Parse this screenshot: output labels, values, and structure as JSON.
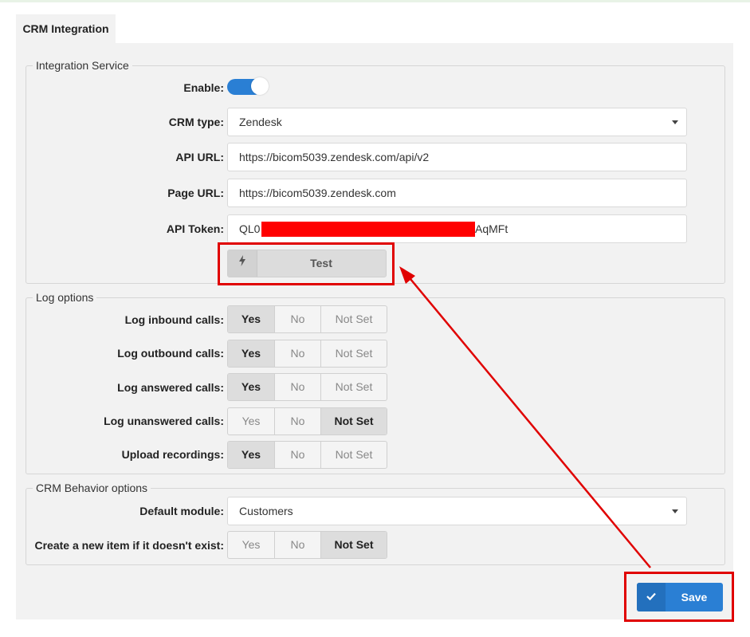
{
  "tab": {
    "label": "CRM Integration"
  },
  "integration": {
    "legend": "Integration Service",
    "enable_label": "Enable:",
    "enabled": true,
    "crm_type_label": "CRM type:",
    "crm_type_value": "Zendesk",
    "api_url_label": "API URL:",
    "api_url_value": "https://bicom5039.zendesk.com/api/v2",
    "page_url_label": "Page URL:",
    "page_url_value": "https://bicom5039.zendesk.com",
    "api_token_label": "API Token:",
    "api_token_prefix": "QL0",
    "api_token_suffix": "AqMFt",
    "test_label": "Test",
    "test_icon": "lightning-icon"
  },
  "log_options": {
    "legend": "Log options",
    "option_labels": [
      "Yes",
      "No",
      "Not Set"
    ],
    "rows": [
      {
        "label": "Log inbound calls:",
        "selected": "Yes"
      },
      {
        "label": "Log outbound calls:",
        "selected": "Yes"
      },
      {
        "label": "Log answered calls:",
        "selected": "Yes"
      },
      {
        "label": "Log unanswered calls:",
        "selected": "Not Set"
      },
      {
        "label": "Upload recordings:",
        "selected": "Yes"
      }
    ]
  },
  "behavior": {
    "legend": "CRM Behavior options",
    "default_module_label": "Default module:",
    "default_module_value": "Customers",
    "create_item_label": "Create a new item if it doesn't exist:",
    "create_item_selected": "Not Set"
  },
  "save": {
    "label": "Save",
    "icon": "check-icon"
  },
  "colors": {
    "accent": "#2a7fd4",
    "highlight": "#e00000",
    "panel_bg": "#f2f2f2"
  }
}
